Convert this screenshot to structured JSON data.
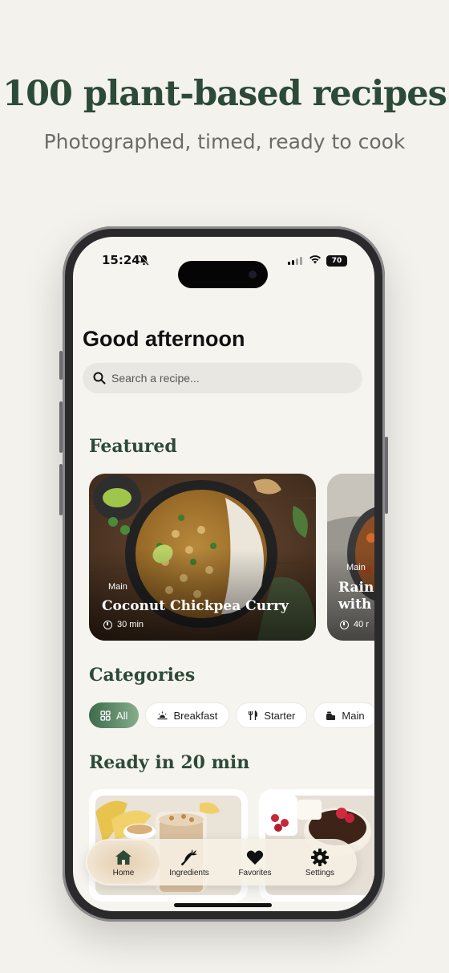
{
  "promo": {
    "headline": "100 plant-based recipes",
    "subline": "Photographed, timed, ready to cook"
  },
  "status_bar": {
    "time": "15:24",
    "battery": "70"
  },
  "greeting": "Good afternoon",
  "search": {
    "placeholder": "Search a recipe..."
  },
  "sections": {
    "featured": "Featured",
    "categories": "Categories",
    "quick": "Ready in 20 min"
  },
  "featured": [
    {
      "tag": "Main",
      "title": "Coconut Chickpea Curry",
      "time": "30 min"
    },
    {
      "tag": "Main",
      "title": "Rain",
      "title2": "with",
      "time": "40 r"
    }
  ],
  "categories": [
    {
      "label": "All",
      "icon": "grid-icon",
      "active": true
    },
    {
      "label": "Breakfast",
      "icon": "sunrise-icon",
      "active": false
    },
    {
      "label": "Starter",
      "icon": "fork-knife-icon",
      "active": false
    },
    {
      "label": "Main",
      "icon": "pot-icon",
      "active": false
    }
  ],
  "tab_bar": {
    "items": [
      {
        "label": "Home",
        "icon": "home-icon",
        "active": true
      },
      {
        "label": "Ingredients",
        "icon": "carrot-icon",
        "active": false
      },
      {
        "label": "Favorites",
        "icon": "heart-icon",
        "active": false
      },
      {
        "label": "Settings",
        "icon": "gear-icon",
        "active": false
      }
    ]
  },
  "colors": {
    "accent": "#2c4a38",
    "background": "#f4f2ec",
    "chip_active": "#4f7a5a"
  }
}
